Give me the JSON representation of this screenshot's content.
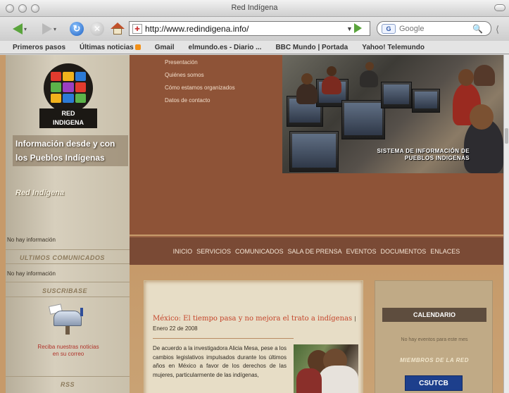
{
  "window": {
    "title": "Red Indígena"
  },
  "toolbar": {
    "url": "http://www.redindigena.info/",
    "search_placeholder": "Google",
    "search_engine_icon": "google-icon"
  },
  "bookmarks": [
    {
      "label": "Primeros pasos"
    },
    {
      "label": "Últimas noticias"
    },
    {
      "label": "Gmail"
    },
    {
      "label": "elmundo.es - Diario ..."
    },
    {
      "label": "BBC Mundo | Portada"
    },
    {
      "label": "Yahoo! Telemundo"
    }
  ],
  "site": {
    "logo_text_line1": "RED",
    "logo_text_line2": "INDIGENA",
    "tagline": "Información desde y con los Pueblos Indígenas",
    "name": "Red Indígena",
    "banner_caption_line1": "SISTEMA DE INFORMACIÓN DE",
    "banner_caption_line2": "PUEBLOS INDIGENAS"
  },
  "top_menu": [
    "Presentación",
    "Quiénes somos",
    "Cómo estamos organizados",
    "Datos de contacto"
  ],
  "sidebar": {
    "no_info_1": "No hay información",
    "comunicados_heading": "ULTIMOS COMUNICADOS",
    "no_info_2": "No hay información",
    "subscribe_heading": "SUSCRIBASE",
    "subscribe_text": "Reciba nuestras noticias en su correo",
    "rss_heading": "RSS"
  },
  "main_nav": [
    "INICIO",
    "SERVICIOS",
    "COMUNICADOS",
    "SALA DE PRENSA",
    "EVENTOS",
    "DOCUMENTOS",
    "ENLACES"
  ],
  "news": {
    "title": "México: El tiempo pasa y no mejora el trato a indígenas",
    "date": "Enero 22 de 2008",
    "body": "De acuerdo a la investigadora Alicia Mesa, pese a los cambios legislativos impulsados durante los últimos años en México a favor de los derechos de las mujeres, particularmente de las indígenas,"
  },
  "calendar": {
    "heading": "CALENDARIO",
    "note": "No hay eventos para este mes",
    "members_heading": "MIEMBROS DE LA RED",
    "member_logo": "CSUTCB"
  },
  "colors": {
    "brown_dark": "#8e5337",
    "nav_bar": "#7a4a35",
    "tan": "#c69a6a",
    "news_title": "#c4442a"
  }
}
